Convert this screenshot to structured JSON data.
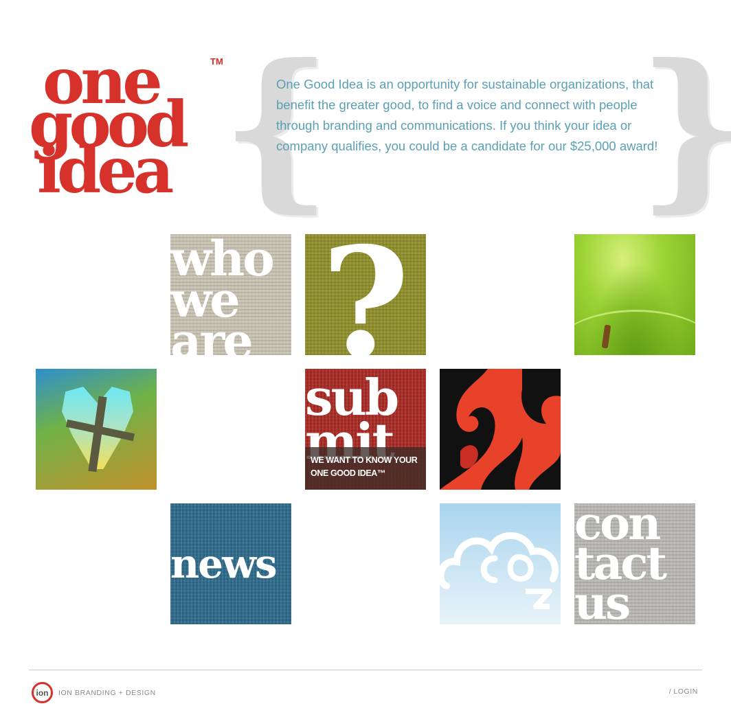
{
  "logo": {
    "line1": "one",
    "line2": "good",
    "line3": "idea",
    "trademark": "TM",
    "color": "#d6312a"
  },
  "intro": {
    "brace_open": "{",
    "brace_close": "}",
    "text": "One Good Idea is an opportunity for sustainable organizations, that benefit the greater good, to find a voice and connect with people through branding and communications. If you think your idea or company qualifies, you could be a candidate for our $25,000 award!",
    "color": "#5b9fb5"
  },
  "tiles": {
    "who_we_are": {
      "text": "who\nwe\nare",
      "color": "#c9c3b4"
    },
    "question": {
      "text": "?",
      "color": "#8f8f2c"
    },
    "apple": {
      "icon": "apple-image"
    },
    "heart": {
      "icon": "heart-image"
    },
    "submit": {
      "text": "sub\nmit",
      "caption_line1": "WE WANT TO KNOW YOUR",
      "caption_line2": "ONE GOOD IDEA™",
      "color": "#a82b25"
    },
    "flame": {
      "icon": "flame-image",
      "color": "#e8422a"
    },
    "news": {
      "text": "news",
      "color": "#2f6b8b"
    },
    "cloud": {
      "icon": "cloud-co2-image"
    },
    "contact": {
      "text": "con\ntact\nus",
      "color": "#b9b8b4"
    }
  },
  "footer": {
    "ion_logo_text": "ion",
    "brand": "ION BRANDING + DESIGN",
    "login_slash": "/",
    "login": "LOGIN"
  }
}
